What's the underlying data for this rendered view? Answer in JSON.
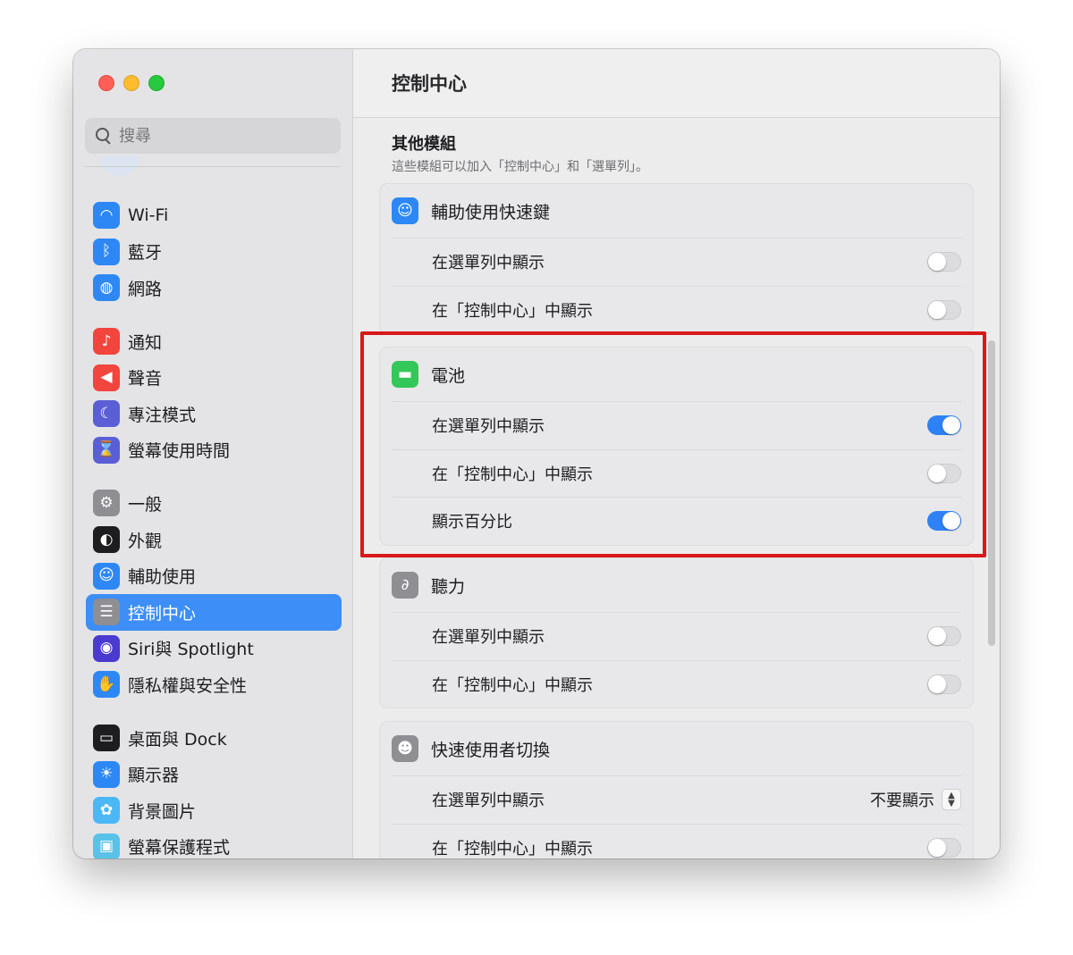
{
  "window": {
    "title": "控制中心"
  },
  "search": {
    "placeholder": "搜尋"
  },
  "sidebar": {
    "groups": [
      [
        {
          "label": "Wi-Fi",
          "icon": "wifi-icon",
          "color": "#2d88f5"
        },
        {
          "label": "藍牙",
          "icon": "bluetooth-icon",
          "color": "#2d88f5"
        },
        {
          "label": "網路",
          "icon": "globe-icon",
          "color": "#2d88f5"
        }
      ],
      [
        {
          "label": "通知",
          "icon": "bell-icon",
          "color": "#f2453d"
        },
        {
          "label": "聲音",
          "icon": "speaker-icon",
          "color": "#f2453d"
        },
        {
          "label": "專注模式",
          "icon": "moon-icon",
          "color": "#5b5fd6"
        },
        {
          "label": "螢幕使用時間",
          "icon": "hourglass-icon",
          "color": "#5b5fd6"
        }
      ],
      [
        {
          "label": "一般",
          "icon": "gear-icon",
          "color": "#8e8e93"
        },
        {
          "label": "外觀",
          "icon": "appearance-icon",
          "color": "#1d1d1f"
        },
        {
          "label": "輔助使用",
          "icon": "accessibility-icon",
          "color": "#2d88f5"
        },
        {
          "label": "控制中心",
          "icon": "control-center-icon",
          "color": "#8e8e93",
          "active": true
        },
        {
          "label": "Siri與 Spotlight",
          "icon": "siri-icon",
          "color": "#4a3ad0"
        },
        {
          "label": "隱私權與安全性",
          "icon": "hand-icon",
          "color": "#2d88f5"
        }
      ],
      [
        {
          "label": "桌面與 Dock",
          "icon": "dock-icon",
          "color": "#1d1d1f"
        },
        {
          "label": "顯示器",
          "icon": "sun-icon",
          "color": "#2d88f5"
        },
        {
          "label": "背景圖片",
          "icon": "flower-icon",
          "color": "#4cb7f5"
        },
        {
          "label": "螢幕保護程式",
          "icon": "screensaver-icon",
          "color": "#5ac1e8"
        }
      ]
    ]
  },
  "section": {
    "title": "其他模組",
    "subtitle": "這些模組可以加入「控制中心」和「選單列」。"
  },
  "modules": [
    {
      "name": "輔助使用快速鍵",
      "icon": "accessibility-icon",
      "color": "#2d88f5",
      "rows": [
        {
          "label": "在選單列中顯示",
          "type": "toggle",
          "on": false
        },
        {
          "label": "在「控制中心」中顯示",
          "type": "toggle",
          "on": false
        }
      ]
    },
    {
      "name": "電池",
      "icon": "battery-icon",
      "color": "#34c759",
      "rows": [
        {
          "label": "在選單列中顯示",
          "type": "toggle",
          "on": true
        },
        {
          "label": "在「控制中心」中顯示",
          "type": "toggle",
          "on": false
        },
        {
          "label": "顯示百分比",
          "type": "toggle",
          "on": true
        }
      ]
    },
    {
      "name": "聽力",
      "icon": "ear-icon",
      "color": "#8e8e93",
      "rows": [
        {
          "label": "在選單列中顯示",
          "type": "toggle",
          "on": false
        },
        {
          "label": "在「控制中心」中顯示",
          "type": "toggle",
          "on": false
        }
      ]
    },
    {
      "name": "快速使用者切換",
      "icon": "user-icon",
      "color": "#8e8e93",
      "rows": [
        {
          "label": "在選單列中顯示",
          "type": "select",
          "value": "不要顯示"
        },
        {
          "label": "在「控制中心」中顯示",
          "type": "toggle",
          "on": false
        }
      ]
    }
  ],
  "highlight_color": "#d8181a"
}
